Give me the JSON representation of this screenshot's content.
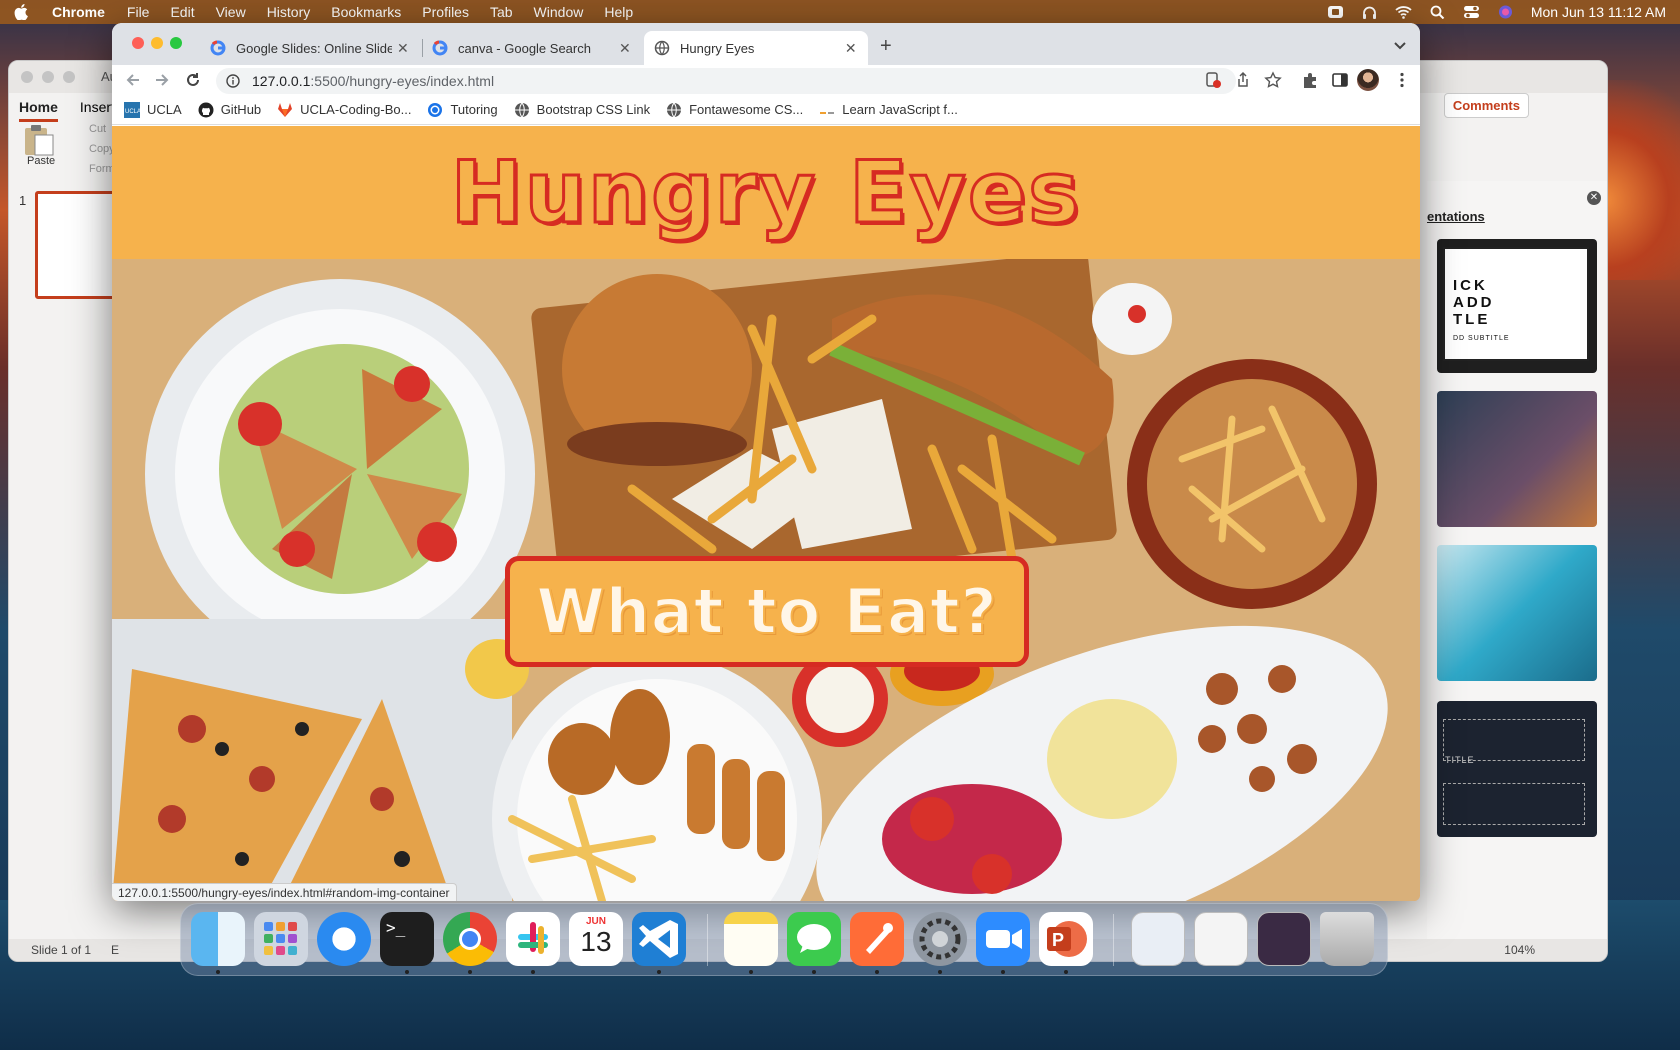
{
  "menubar": {
    "app_name": "Chrome",
    "items": [
      "File",
      "Edit",
      "View",
      "History",
      "Bookmarks",
      "Profiles",
      "Tab",
      "Window",
      "Help"
    ],
    "clock": "Mon Jun 13  11:12 AM"
  },
  "powerpoint": {
    "title": "Aut",
    "tabs": [
      "Home",
      "Insert"
    ],
    "paste_label": "Paste",
    "clipboard": [
      "Cut",
      "Copy",
      "Form"
    ],
    "slide_number": "1",
    "comments_label": "Comments",
    "design_link": "entations",
    "template_text": [
      "ICK",
      "ADD",
      "TLE"
    ],
    "template_subtitle": "DD SUBTITLE",
    "template_title2": "TITLE",
    "status_left": "Slide 1 of 1",
    "status_extra": "E",
    "zoom": "104%"
  },
  "chrome": {
    "tabs": [
      {
        "title": "Google Slides: Online Slidesho",
        "active": false
      },
      {
        "title": "canva - Google Search",
        "active": false
      },
      {
        "title": "Hungry Eyes",
        "active": true
      }
    ],
    "url_host": "127.0.0.1",
    "url_path": ":5500/hungry-eyes/index.html",
    "bookmarks": [
      "UCLA",
      "GitHub",
      "UCLA-Coding-Bo...",
      "Tutoring",
      "Bootstrap CSS Link",
      "Fontawesome CS...",
      "Learn JavaScript f..."
    ],
    "status_link": "127.0.0.1:5500/hungry-eyes/index.html#random-img-container"
  },
  "page": {
    "site_title": "Hungry Eyes",
    "cta_label": "What to Eat?"
  },
  "dock": {
    "calendar_month": "JUN",
    "calendar_day": "13",
    "apps": [
      "finder-icon",
      "launchpad-icon",
      "safari-icon",
      "terminal-icon",
      "chrome-icon",
      "slack-icon",
      "calendar-icon",
      "vscode-icon",
      "notes-icon",
      "messages-icon",
      "postman-icon",
      "system-preferences-icon",
      "zoom-icon",
      "powerpoint-icon"
    ]
  },
  "colors": {
    "header_bg": "#f6b24c",
    "accent_red": "#d62b22",
    "cta_text": "#fff6e8"
  }
}
